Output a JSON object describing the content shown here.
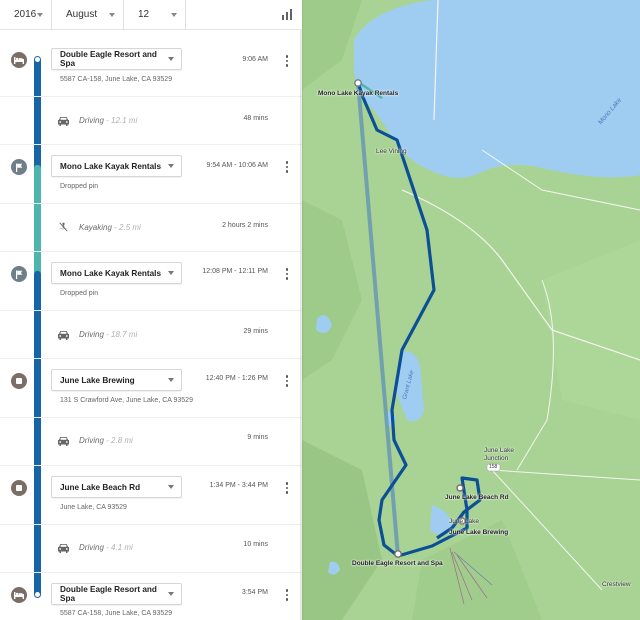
{
  "topbar": {
    "year": "2016",
    "month": "August",
    "day": "12",
    "stats_icon": "bar-chart-icon"
  },
  "timeline": {
    "places": [
      {
        "icon": "hotel-icon",
        "name": "Double Eagle Resort and Spa",
        "address": "5587 CA-158, June Lake, CA 93529",
        "time": "9:06 AM"
      },
      {
        "icon": "flag-icon",
        "name": "Mono Lake Kayak Rentals",
        "address": "Dropped pin",
        "time": "9:54 AM - 10:06 AM"
      },
      {
        "icon": "flag-icon",
        "name": "Mono Lake Kayak Rentals",
        "address": "Dropped pin",
        "time": "12:08 PM - 12:11 PM"
      },
      {
        "icon": "place-icon",
        "name": "June Lake Brewing",
        "address": "131 S Crawford Ave, June Lake, CA 93529",
        "time": "12:40 PM - 1:26 PM"
      },
      {
        "icon": "place-icon",
        "name": "June Lake Beach Rd",
        "address": "June Lake, CA 93529",
        "time": "1:34 PM - 3:44 PM"
      },
      {
        "icon": "hotel-icon",
        "name": "Double Eagle Resort and Spa",
        "address": "5587 CA-158, June Lake, CA 93529",
        "time": "3:54 PM"
      }
    ],
    "activities": [
      {
        "icon": "car-icon",
        "label": "Driving",
        "distance": " - 12.1 mi",
        "duration": "48 mins"
      },
      {
        "icon": "kayak-icon",
        "label": "Kayaking",
        "distance": " - 2.5 mi",
        "duration": "2 hours 2 mins"
      },
      {
        "icon": "car-icon",
        "label": "Driving",
        "distance": " - 18.7 mi",
        "duration": "29 mins"
      },
      {
        "icon": "car-icon",
        "label": "Driving",
        "distance": " - 2.8 mi",
        "duration": "9 mins"
      },
      {
        "icon": "car-icon",
        "label": "Driving",
        "distance": " - 4.1 mi",
        "duration": "10 mins"
      }
    ]
  },
  "map": {
    "labels": {
      "kayak": "Mono Lake Kayak Rentals",
      "lee_vining": "Lee Vining",
      "mono_lake": "Mono Lake",
      "grant_lake": "Grant Lake",
      "june_lake_junction": "June Lake Junction",
      "highway": "158",
      "beach_rd": "June Lake Beach Rd",
      "june_lake": "June Lake",
      "brewing": "June Lake Brewing",
      "resort": "Double Eagle Resort and Spa",
      "crestview": "Crestview"
    },
    "colors": {
      "route": "#0d4f96",
      "kayak_route": "#4db6ac",
      "land": "#a8d394",
      "water": "#9fcdf2"
    }
  }
}
